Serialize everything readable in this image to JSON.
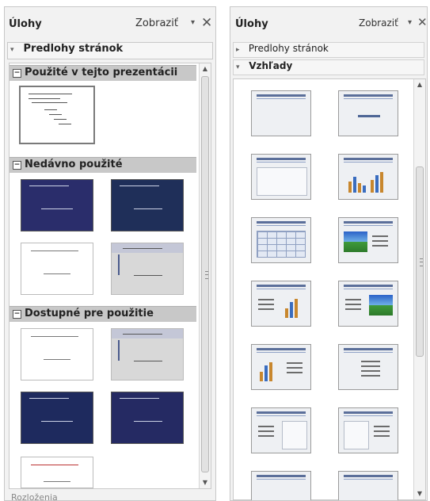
{
  "panel_left": {
    "title": "Úlohy",
    "view_menu": "Zobraziť",
    "section": "Predlohy stránok",
    "groups": [
      "Použité v tejto prezentácii",
      "Nedávno použité",
      "Dostupné pre použitie"
    ],
    "footer_cut": "Rozloženia"
  },
  "panel_right": {
    "title": "Úlohy",
    "view_menu": "Zobraziť",
    "section_collapsed": "Predlohy stránok",
    "section_open": "Vzhľady"
  },
  "icons": {
    "expand": "▸",
    "collapse": "▾",
    "dropdown": "▾",
    "close": "✕",
    "group_minus": "−"
  }
}
